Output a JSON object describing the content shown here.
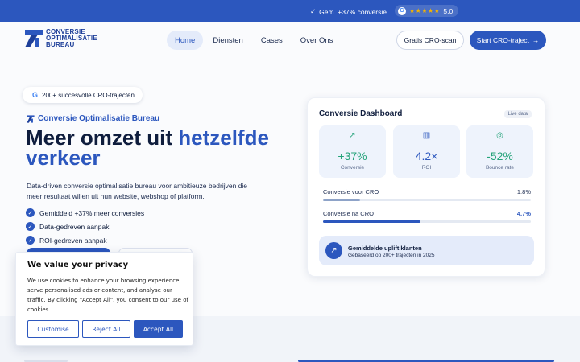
{
  "topbar": {
    "promo": "Gem. +37% conversie",
    "rating": "5.0",
    "stars": "★★★★★",
    "google_letter": "G",
    "check_glyph": "✓"
  },
  "logo": {
    "line1": "CONVERSIE",
    "line2": "OPTIMALISATIE",
    "line3": "BUREAU"
  },
  "nav": {
    "items": [
      "Home",
      "Diensten",
      "Cases",
      "Over Ons"
    ],
    "outline_cta": "Gratis CRO-scan",
    "primary_cta": "Start CRO-traject",
    "primary_arrow": "→"
  },
  "hero": {
    "pill": "200+ succesvolle CRO-trajecten",
    "pill_g": "G",
    "eyebrow": "Conversie Optimalisatie Bureau",
    "headline_a": "Meer omzet uit ",
    "headline_b": "hetzelfde",
    "headline_c": "verkeer",
    "lead": "Data-driven conversie optimalisatie bureau voor ambitieuze bedrijven die meer resultaat willen uit hun website, webshop of platform.",
    "checks": [
      "Gemiddeld +37% meer conversies",
      "Data-gedreven aanpak",
      "ROI-gedreven aanpak"
    ],
    "check_glyph": "✓"
  },
  "dashboard": {
    "title": "Conversie Dashboard",
    "badge": "Live data",
    "stats": [
      {
        "icon": "trend-up-icon",
        "glyph": "↗",
        "value": "+37%",
        "label": "Conversie",
        "color": "#25a37a"
      },
      {
        "icon": "bar-chart-icon",
        "glyph": "▥",
        "value": "4.2×",
        "label": "ROI",
        "color": "#2c57be"
      },
      {
        "icon": "target-icon",
        "glyph": "◎",
        "value": "-52%",
        "label": "Bounce rate",
        "color": "#25a37a"
      }
    ],
    "bars": [
      {
        "label": "Conversie voor CRO",
        "value": "1.8%",
        "fill": 0.18,
        "color": "#8ea3c8"
      },
      {
        "label": "Conversie na CRO",
        "value": "4.7%",
        "fill": 0.47,
        "color": "#2c57be"
      }
    ],
    "uplift_title": "Gemiddelde uplift klanten",
    "uplift_sub": "Gebaseerd op 200+ trajecten in 2025",
    "uplift_glyph": "↗"
  },
  "cookie": {
    "title": "We value your privacy",
    "body": "We use cookies to enhance your browsing experience, serve personalised ads or content, and analyse our traffic. By clicking \"Accept All\", you consent to our use of cookies.",
    "customise": "Customise",
    "reject": "Reject All",
    "accept": "Accept All"
  },
  "colors": {
    "brand": "#2c57be",
    "navy": "#0f1d3d",
    "green": "#25a37a"
  }
}
